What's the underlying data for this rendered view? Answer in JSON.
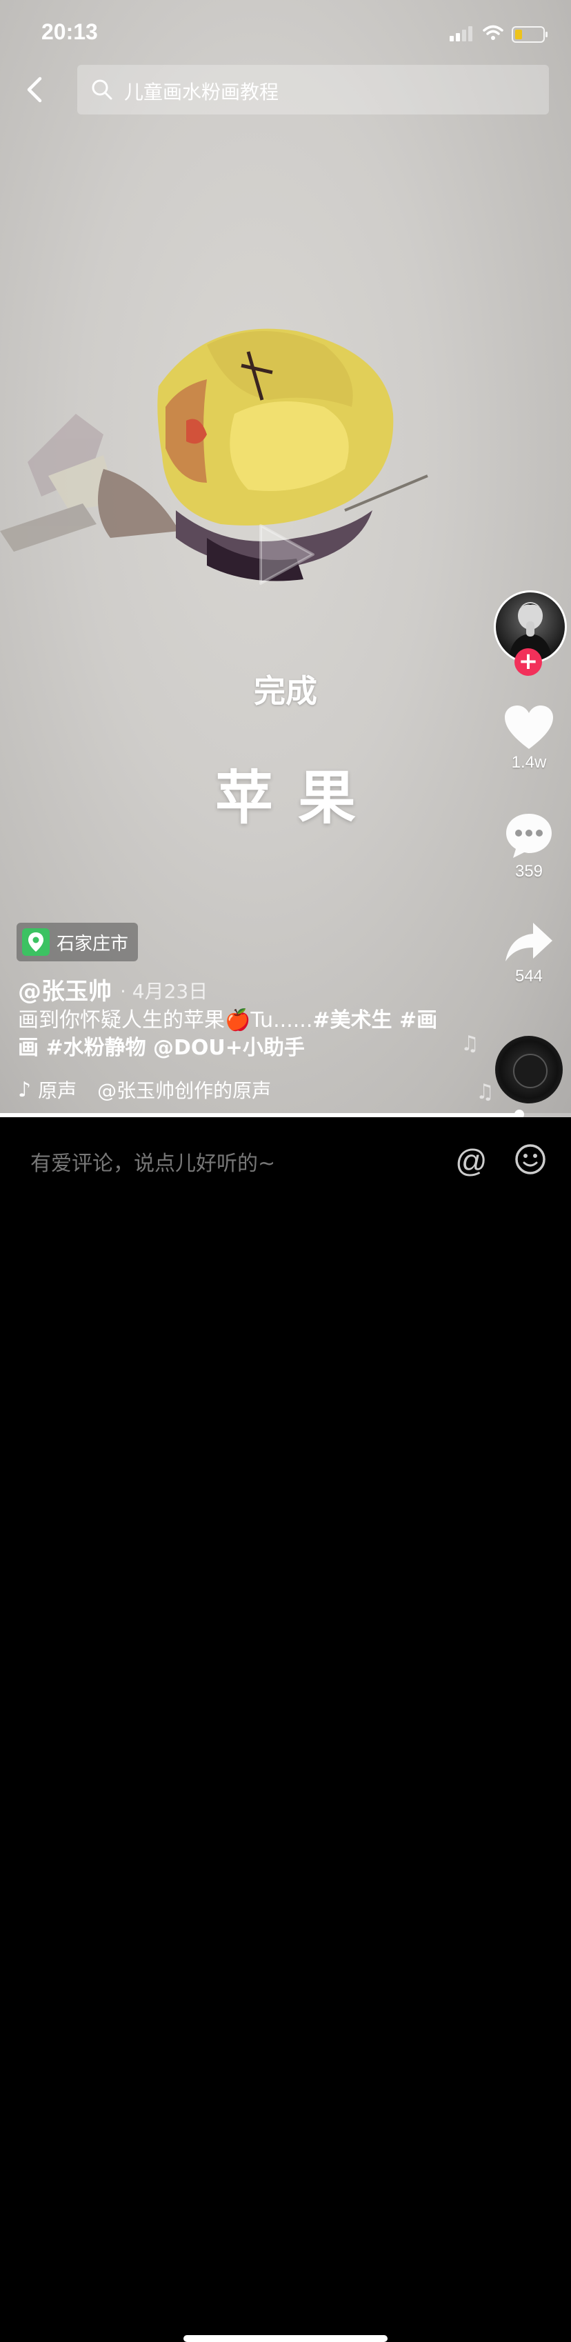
{
  "status_bar": {
    "time": "20:13",
    "battery_color": "#f5c400"
  },
  "search": {
    "placeholder": "儿童画水粉画教程",
    "icon": "search-icon"
  },
  "video": {
    "overlay_done": "完成",
    "overlay_title": "苹果",
    "progress": 0.91
  },
  "sidebar": {
    "follow_symbol": "+",
    "likes": "1.4w",
    "comments": "359",
    "shares": "544"
  },
  "post": {
    "location": "石家庄市",
    "author": "@张玉帅",
    "date": "· 4月23日",
    "desc_text": "画到你怀疑人生的苹果🍎Tu......",
    "tags": "#美术生 #画画 #水粉静物 @DOU+小助手",
    "music_left": "原声",
    "music_right": "@张玉帅创作的原声"
  },
  "comment_bar": {
    "placeholder": "有爱评论，说点儿好听的~",
    "at_symbol": "@"
  },
  "colors": {
    "follow": "#f2305a",
    "location_pin": "#3cc262",
    "comment_bg": "#000000"
  }
}
